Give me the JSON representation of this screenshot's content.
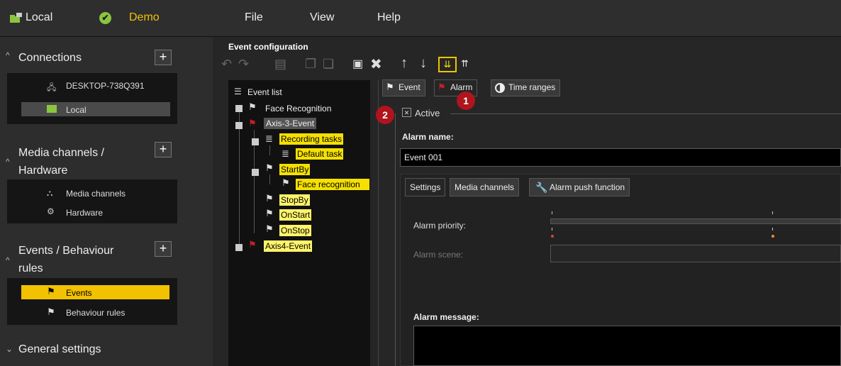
{
  "topbar": {
    "location_icon": "folder-network-icon",
    "location_label": "Local",
    "status_icon": "check-circle-icon",
    "site_label": "Demo",
    "menu": [
      "File",
      "View",
      "Help"
    ]
  },
  "sidebar": {
    "connections_title": "Connections",
    "connections": [
      "DESKTOP-738Q391",
      "Local"
    ],
    "media_title": "Media channels /\nHardware",
    "media_items": [
      "Media channels",
      "Hardware"
    ],
    "events_title": "Events / Behaviour\nrules",
    "events_items": [
      "Events",
      "Behaviour rules"
    ],
    "general_title": "General settings",
    "plus": "+"
  },
  "center": {
    "title": "Event configuration",
    "tree": {
      "root": "Event list",
      "nodes": [
        "Face Recognition",
        "Axis-3-Event",
        "Recording tasks",
        "Default task",
        "StartBy",
        "Face recognition",
        "StopBy",
        "OnStart",
        "OnStop",
        "Axis4-Event"
      ]
    }
  },
  "detail": {
    "tabs": [
      "Event",
      "Alarm",
      "Time ranges"
    ],
    "badge1": "1",
    "badge2": "2",
    "active_label": "Active",
    "active_mark": "✕",
    "alarm_name_label": "Alarm name:",
    "alarm_name_value": "Event 001",
    "subtabs": [
      "Settings",
      "Media channels",
      "Alarm push function"
    ],
    "alarm_priority_label": "Alarm priority:",
    "alarm_scene_label": "Alarm scene:",
    "alarm_message_label": "Alarm message:"
  },
  "colors": {
    "accent_yellow": "#f2c200",
    "badge_red": "#b0141c",
    "status_green": "#8bc53f"
  }
}
